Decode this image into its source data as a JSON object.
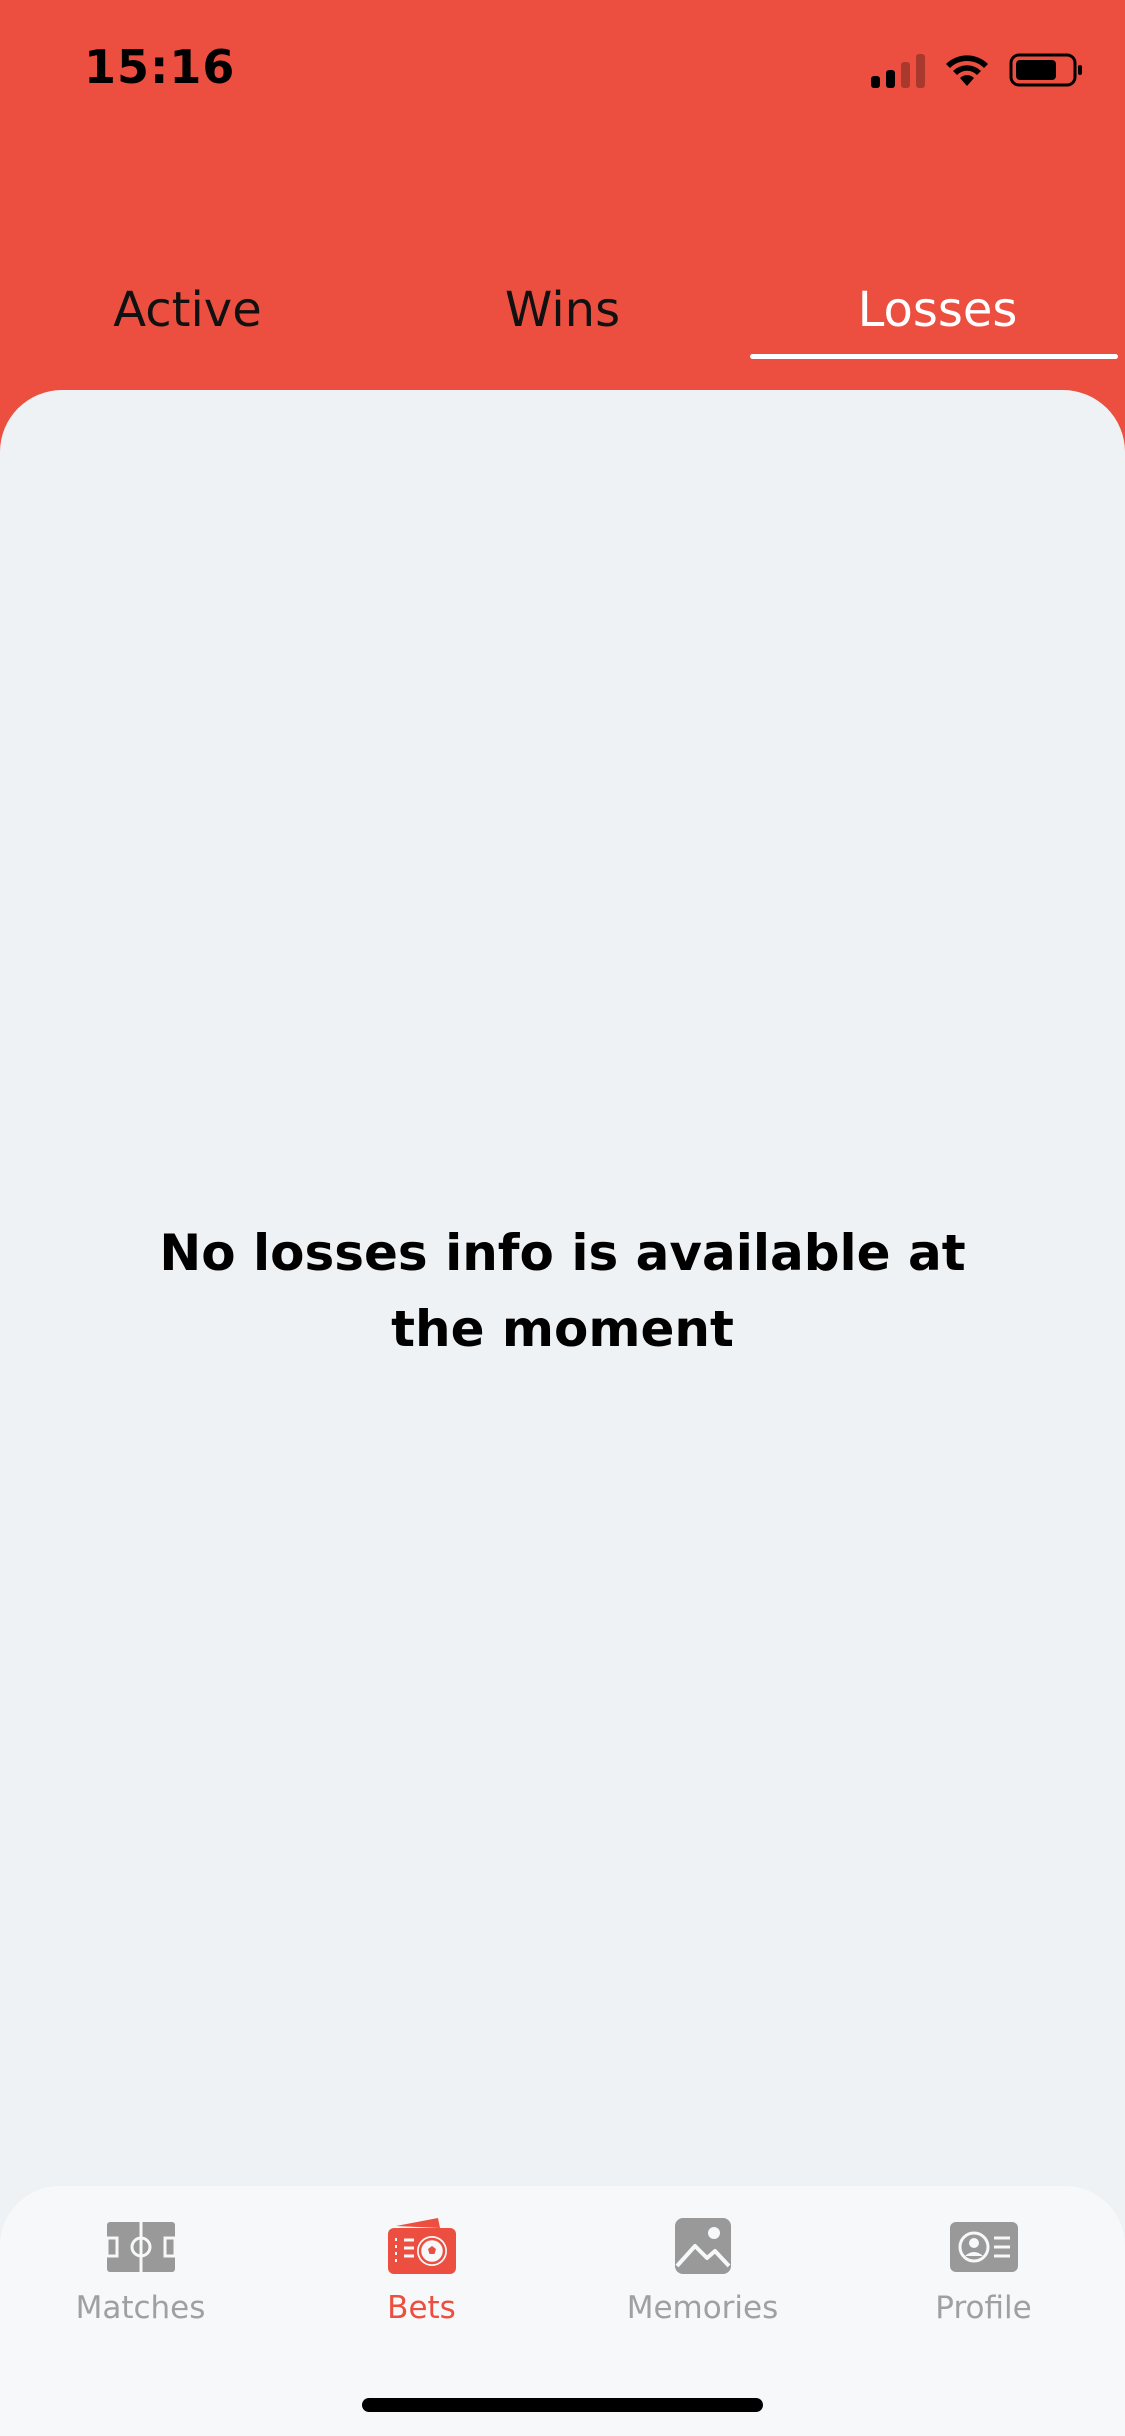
{
  "status_bar": {
    "time": "15:16"
  },
  "tabs": [
    {
      "label": "Active",
      "active": false
    },
    {
      "label": "Wins",
      "active": false
    },
    {
      "label": "Losses",
      "active": true
    }
  ],
  "content": {
    "empty_message_line1": "No losses info is available at",
    "empty_message_line2": "the moment"
  },
  "bottom_nav": {
    "items": [
      {
        "label": "Matches",
        "icon": "pitch-icon",
        "active": false
      },
      {
        "label": "Bets",
        "icon": "ticket-ball-icon",
        "active": true
      },
      {
        "label": "Memories",
        "icon": "image-icon",
        "active": false
      },
      {
        "label": "Profile",
        "icon": "id-card-icon",
        "active": false
      }
    ]
  },
  "colors": {
    "accent": "#EC4F3F",
    "content_bg": "#EFF2F5",
    "inactive_icon": "#999999"
  }
}
